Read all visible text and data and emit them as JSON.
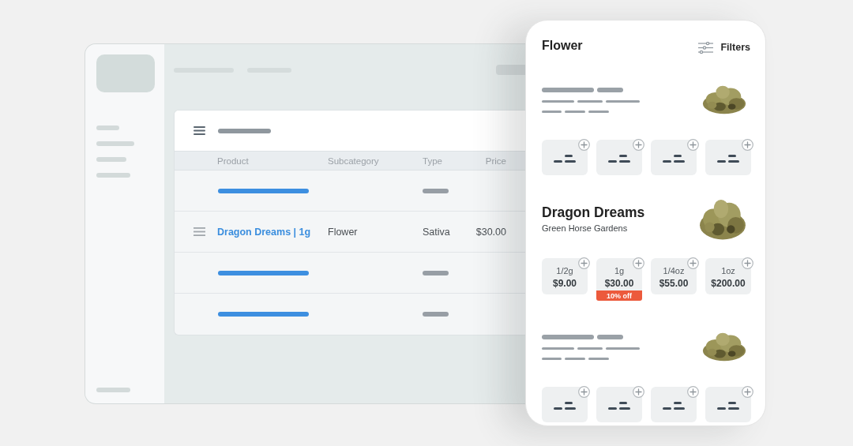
{
  "admin": {
    "table": {
      "columns": [
        "Product",
        "Subcategory",
        "Type",
        "Price"
      ],
      "rows": [
        {
          "kind": "placeholder"
        },
        {
          "kind": "product",
          "product": "Dragon Dreams | 1g",
          "subcategory": "Flower",
          "type": "Sativa",
          "price": "$30.00"
        },
        {
          "kind": "placeholder"
        },
        {
          "kind": "placeholder"
        }
      ]
    }
  },
  "menu": {
    "title": "Flower",
    "filters": "Filters",
    "products": [
      {
        "kind": "placeholder",
        "options": [
          {
            "kind": "placeholder"
          },
          {
            "kind": "placeholder"
          },
          {
            "kind": "placeholder"
          },
          {
            "kind": "placeholder"
          }
        ]
      },
      {
        "kind": "product",
        "name": "Dragon Dreams",
        "brand": "Green Horse Gardens",
        "options": [
          {
            "kind": "size",
            "weight": "1/2g",
            "price": "$9.00"
          },
          {
            "kind": "size",
            "weight": "1g",
            "price": "$30.00",
            "badge": "10% off"
          },
          {
            "kind": "size",
            "weight": "1/4oz",
            "price": "$55.00"
          },
          {
            "kind": "size",
            "weight": "1oz",
            "price": "$200.00"
          }
        ]
      },
      {
        "kind": "placeholder",
        "options": [
          {
            "kind": "placeholder"
          },
          {
            "kind": "placeholder"
          },
          {
            "kind": "placeholder"
          },
          {
            "kind": "placeholder"
          }
        ]
      }
    ]
  }
}
